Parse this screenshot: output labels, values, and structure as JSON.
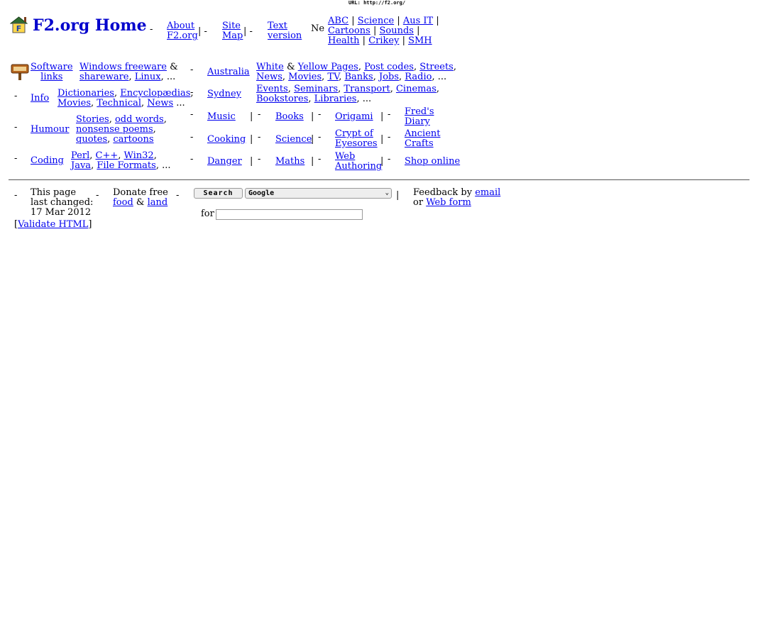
{
  "url_caption": "URL: http://f2.org/",
  "header": {
    "title": "F2.org Home",
    "about": [
      "About",
      "F2.org"
    ],
    "sitemap": [
      "Site",
      "Map"
    ],
    "textver": [
      "Text",
      "version"
    ],
    "news_cut": "Ne",
    "news_row1": [
      "ABC",
      "Science",
      "Aus IT"
    ],
    "news_row2": [
      "Cartoons",
      "Sounds"
    ],
    "news_row3": [
      "Health",
      "Crikey",
      "SMH"
    ]
  },
  "left": {
    "software": {
      "label": [
        "Software",
        "links"
      ],
      "line1_link": "Windows freeware",
      "line1_text": " &",
      "line2_links": [
        "shareware",
        "Linux"
      ],
      "more": ", ..."
    },
    "info": {
      "label": "Info",
      "line1_links": [
        "Dictionaries",
        "Encyclopædias"
      ],
      "line2_links": [
        "Movies",
        "Technical",
        "News"
      ],
      "more": " ..."
    },
    "humour": {
      "label": "Humour",
      "line1_links": [
        "Stories",
        "odd words"
      ],
      "line2_link": "nonsense poems",
      "line3_links": [
        "quotes",
        "cartoons"
      ]
    },
    "coding": {
      "label": "Coding",
      "line1_links": [
        "Perl",
        "C++",
        "Win32"
      ],
      "line2_links": [
        "Java",
        "File Formats"
      ],
      "more": ", ..."
    }
  },
  "right": {
    "australia": {
      "label": "Australia",
      "line1": [
        "White",
        "Yellow Pages",
        "Post codes",
        "Streets"
      ],
      "line2": [
        "News",
        "Movies",
        "TV",
        "Banks",
        "Jobs",
        "Radio"
      ],
      "more": ", ..."
    },
    "sydney": {
      "label": "Sydney",
      "line1": [
        "Events",
        "Seminars",
        "Transport",
        "Cinemas"
      ],
      "line2": [
        "Bookstores",
        "Libraries"
      ],
      "more": ", ..."
    },
    "grid": [
      [
        "Music",
        "Books",
        "Origami",
        "Fred's Diary"
      ],
      [
        "Cooking",
        "Science",
        "Crypt of Eyesores",
        "Ancient Crafts"
      ],
      [
        "Danger",
        "Maths",
        "Web Authoring",
        "Shop online"
      ]
    ]
  },
  "footer": {
    "changed": [
      "This page",
      "last changed:",
      "17 Mar 2012"
    ],
    "validate": "Validate HTML",
    "donate_text": "Donate free",
    "donate_links": [
      "food",
      "land"
    ],
    "search_button": "Search",
    "search_engine": "Google",
    "search_for": "for",
    "feedback_text": "Feedback by",
    "feedback_email": "email",
    "feedback_or": "or",
    "feedback_form": "Web form"
  },
  "separators": {
    "dash": "-",
    "bar": "|",
    "comma": ", ",
    "amp": " & "
  },
  "colors": {
    "link": "#0000ee",
    "title": "#0000cc",
    "rule": "#555555"
  }
}
